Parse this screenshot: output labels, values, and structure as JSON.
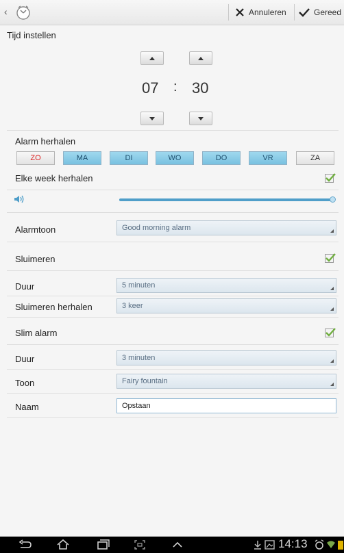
{
  "toolbar": {
    "cancel_label": "Annuleren",
    "done_label": "Gereed"
  },
  "section_title": "Tijd instellen",
  "time": {
    "hours": "07",
    "separator": ":",
    "minutes": "30"
  },
  "repeat": {
    "label": "Alarm herhalen",
    "days": [
      {
        "label": "ZO",
        "selected": false
      },
      {
        "label": "MA",
        "selected": true
      },
      {
        "label": "DI",
        "selected": true
      },
      {
        "label": "WO",
        "selected": true
      },
      {
        "label": "DO",
        "selected": true
      },
      {
        "label": "VR",
        "selected": true
      },
      {
        "label": "ZA",
        "selected": false
      }
    ],
    "weekly_label": "Elke week herhalen",
    "weekly_checked": true
  },
  "volume": {
    "level": 1.0
  },
  "settings": {
    "tone_label": "Alarmtoon",
    "tone_value": "Good morning alarm",
    "snooze_label": "Sluimeren",
    "snooze_checked": true,
    "snooze_duration_label": "Duur",
    "snooze_duration_value": "5 minuten",
    "snooze_repeat_label": "Sluimeren herhalen",
    "snooze_repeat_value": "3 keer",
    "smart_label": "Slim alarm",
    "smart_checked": true,
    "smart_duration_label": "Duur",
    "smart_duration_value": "3 minuten",
    "smart_tone_label": "Toon",
    "smart_tone_value": "Fairy fountain",
    "name_label": "Naam",
    "name_value": "Opstaan"
  },
  "status": {
    "time": "14:13"
  },
  "colors": {
    "accent": "#4f9ec9",
    "day_selected": "#8fd0ea",
    "sunday_text": "#dd2222",
    "check_green": "#6fae3e"
  }
}
